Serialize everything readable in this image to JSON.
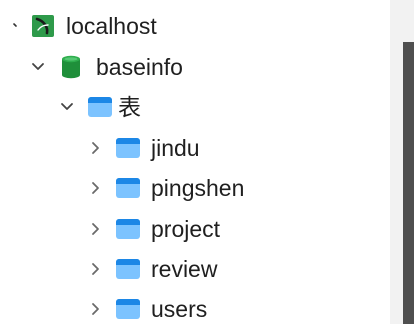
{
  "tree": {
    "connection": {
      "label": "localhost",
      "icon": "leaf-connection-icon",
      "expanded": true,
      "accent": "#2e9a4a"
    },
    "database": {
      "label": "baseinfo",
      "icon": "database-icon",
      "expanded": true,
      "accent": "#1f8f3a"
    },
    "tables_folder": {
      "label": "表",
      "icon": "table-icon",
      "expanded": true,
      "accent": "#4aa3f0"
    },
    "tables": [
      {
        "label": "jindu",
        "icon": "table-icon",
        "expanded": false
      },
      {
        "label": "pingshen",
        "icon": "table-icon",
        "expanded": false
      },
      {
        "label": "project",
        "icon": "table-icon",
        "expanded": false
      },
      {
        "label": "review",
        "icon": "table-icon",
        "expanded": false
      },
      {
        "label": "users",
        "icon": "table-icon",
        "expanded": false
      }
    ]
  },
  "scrollbar": {
    "thumb_color": "#4f4f4f",
    "track_color": "#f2f2f2"
  }
}
